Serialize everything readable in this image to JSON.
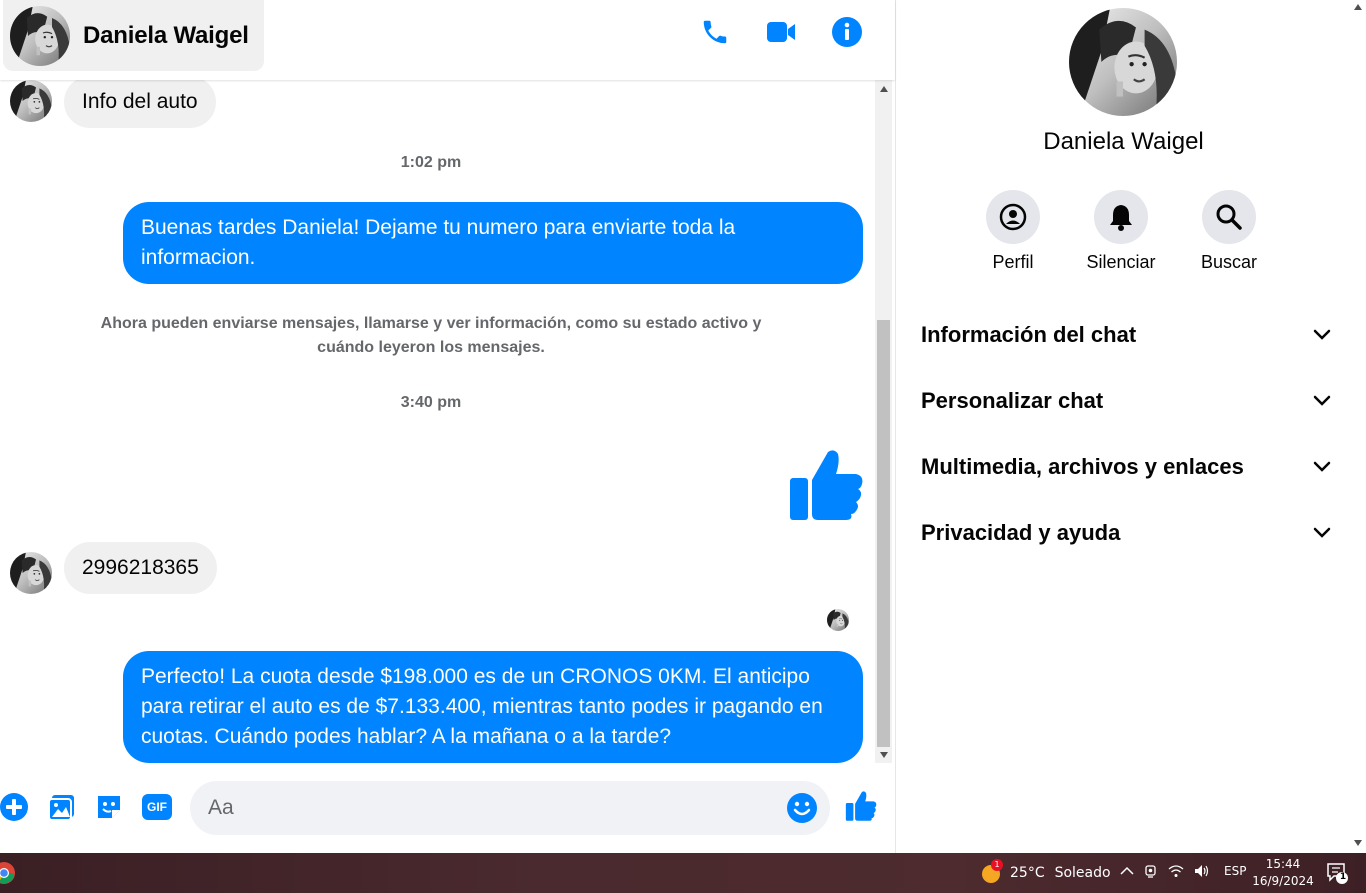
{
  "contact": {
    "name": "Daniela Waigel"
  },
  "header": {
    "icons": [
      "phone-icon",
      "video-icon",
      "info-icon"
    ]
  },
  "messages": {
    "incoming_1": "Info del auto",
    "time_1": "1:02 pm",
    "outgoing_1": "Buenas tardes Daniela! Dejame tu numero para enviarte toda la informacion.",
    "system_notice": "Ahora pueden enviarse mensajes, llamarse y ver información, como su estado activo y cuándo leyeron los mensajes.",
    "time_2": "3:40 pm",
    "incoming_2": "2996218365",
    "outgoing_2": "Perfecto! La cuota desde $198.000 es de un CRONOS 0KM. El anticipo para retirar el auto es de $7.133.400, mientras tanto podes ir pagando en cuotas. Cuándo podes hablar? A la mañana o a la tarde?"
  },
  "composer": {
    "placeholder": "Aa",
    "gif_label": "GIF"
  },
  "info_panel": {
    "actions": [
      {
        "label": "Perfil",
        "icon": "profile-icon"
      },
      {
        "label": "Silenciar",
        "icon": "bell-icon"
      },
      {
        "label": "Buscar",
        "icon": "search-icon"
      }
    ],
    "sections": [
      "Información del chat",
      "Personalizar chat",
      "Multimedia, archivos y enlaces",
      "Privacidad y ayuda"
    ]
  },
  "taskbar": {
    "weather_temp": "25°C",
    "weather_desc": "Soleado",
    "weather_badge": "1",
    "language": "ESP",
    "time": "15:44",
    "date": "16/9/2024",
    "notification_count": "1"
  },
  "colors": {
    "accent": "#0084ff",
    "bubble_in": "#f0f0f0",
    "muted_text": "#65676b"
  }
}
